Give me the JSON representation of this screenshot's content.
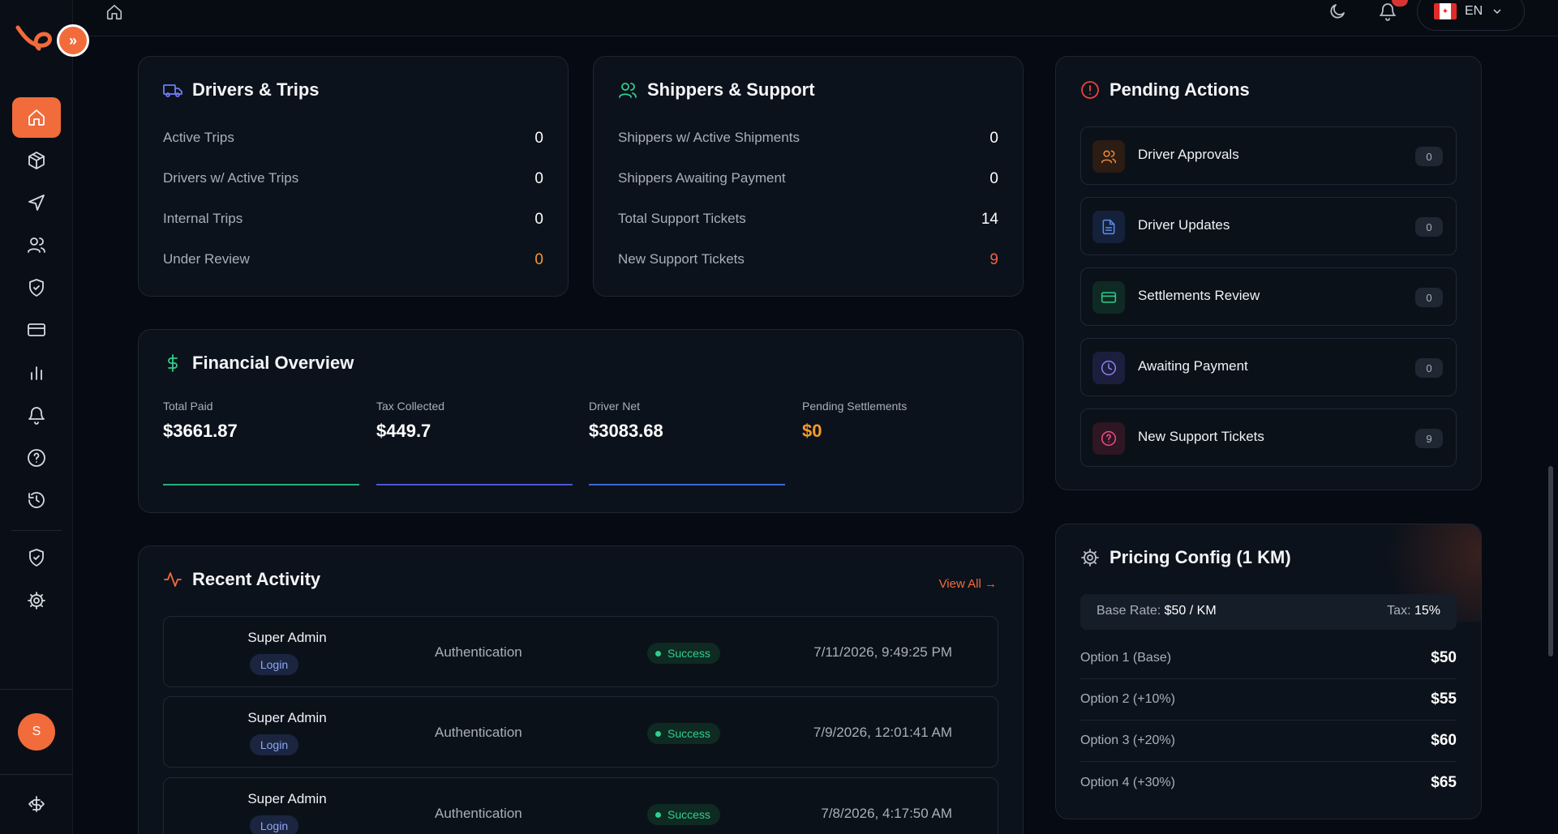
{
  "topbar": {
    "language": "EN"
  },
  "sidebar": {
    "avatar_initial": "S",
    "nav": [
      "home",
      "package",
      "send",
      "users",
      "shield",
      "credit-card",
      "bar-chart",
      "bell",
      "help",
      "history",
      "shield-check",
      "settings"
    ]
  },
  "drivers_trips": {
    "title": "Drivers & Trips",
    "rows": [
      {
        "label": "Active Trips",
        "value": "0"
      },
      {
        "label": "Drivers w/ Active Trips",
        "value": "0"
      },
      {
        "label": "Internal Trips",
        "value": "0"
      },
      {
        "label": "Under Review",
        "value": "0"
      }
    ]
  },
  "shippers_support": {
    "title": "Shippers & Support",
    "rows": [
      {
        "label": "Shippers w/ Active Shipments",
        "value": "0"
      },
      {
        "label": "Shippers Awaiting Payment",
        "value": "0"
      },
      {
        "label": "Total Support Tickets",
        "value": "14"
      },
      {
        "label": "New Support Tickets",
        "value": "9"
      }
    ]
  },
  "financial": {
    "title": "Financial Overview",
    "cols": [
      {
        "label": "Total Paid",
        "value": "$3661.87"
      },
      {
        "label": "Tax Collected",
        "value": "$449.7"
      },
      {
        "label": "Driver Net",
        "value": "$3083.68"
      },
      {
        "label": "Pending Settlements",
        "value": "$0"
      }
    ]
  },
  "activity": {
    "title": "Recent Activity",
    "view_all": "View All",
    "rows": [
      {
        "user": "Super Admin",
        "action": "Login",
        "category": "Authentication",
        "status": "Success",
        "time": "7/11/2026, 9:49:25 PM"
      },
      {
        "user": "Super Admin",
        "action": "Login",
        "category": "Authentication",
        "status": "Success",
        "time": "7/9/2026, 12:01:41 AM"
      },
      {
        "user": "Super Admin",
        "action": "Login",
        "category": "Authentication",
        "status": "Success",
        "time": "7/8/2026, 4:17:50 AM"
      }
    ]
  },
  "pending": {
    "title": "Pending Actions",
    "items": [
      {
        "label": "Driver Approvals",
        "count": "0"
      },
      {
        "label": "Driver Updates",
        "count": "0"
      },
      {
        "label": "Settlements Review",
        "count": "0"
      },
      {
        "label": "Awaiting Payment",
        "count": "0"
      },
      {
        "label": "New Support Tickets",
        "count": "9"
      }
    ]
  },
  "pricing": {
    "title": "Pricing Config (1 KM)",
    "base_rate_label": "Base Rate:",
    "base_rate_value": "$50 / KM",
    "tax_label": "Tax:",
    "tax_value": "15%",
    "options": [
      {
        "label": "Option 1 (Base)",
        "price": "$50"
      },
      {
        "label": "Option 2 (+10%)",
        "price": "$55"
      },
      {
        "label": "Option 3 (+20%)",
        "price": "$60"
      },
      {
        "label": "Option 4 (+30%)",
        "price": "$65"
      }
    ]
  },
  "colors": {
    "accent": "#f26b3a",
    "success": "#2fcf8d",
    "warning": "#f59a2b"
  }
}
